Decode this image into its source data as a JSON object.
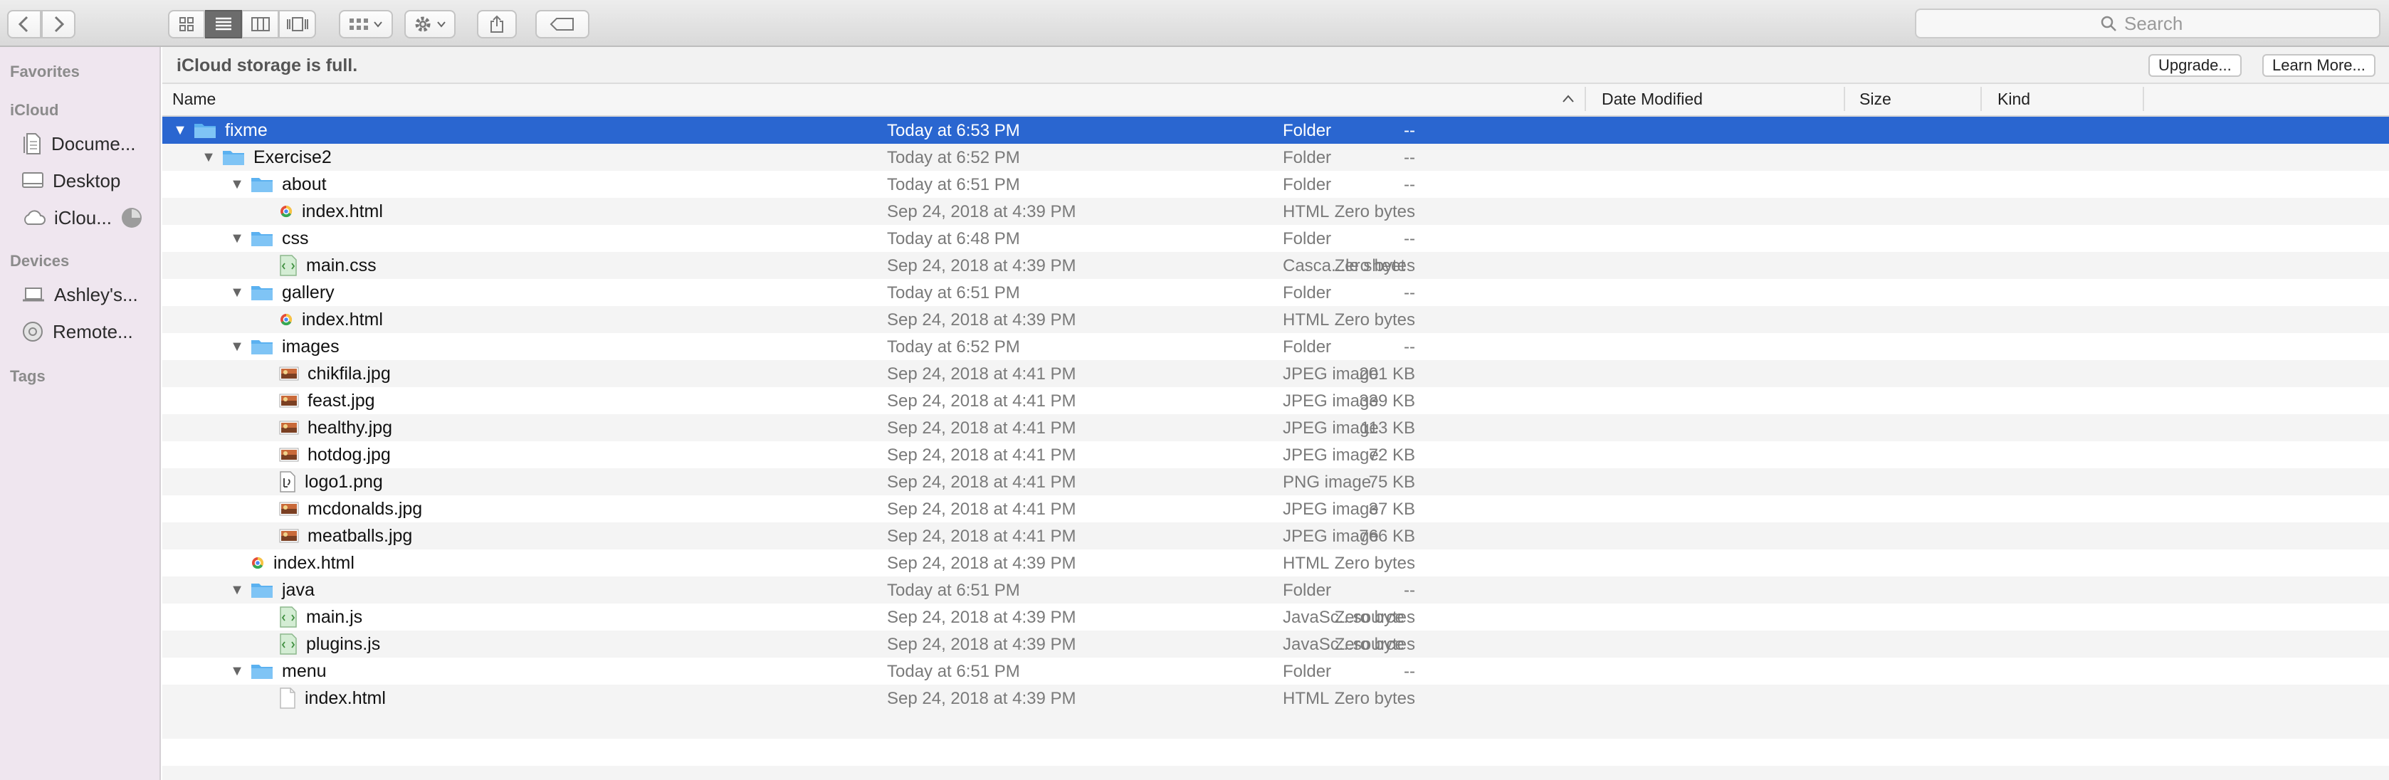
{
  "toolbar": {
    "back_icon": "chevron-left-icon",
    "forward_icon": "chevron-right-icon",
    "views": [
      "icon-view-icon",
      "list-view-icon",
      "column-view-icon",
      "gallery-view-icon"
    ],
    "active_view": "list",
    "group_icon": "group-icon",
    "action_icon": "gear-icon",
    "share_icon": "share-icon",
    "tag_icon": "tag-icon",
    "search_placeholder": "Search"
  },
  "sidebar": {
    "favorites_label": "Favorites",
    "icloud_label": "iCloud",
    "icloud_items": [
      "Docume...",
      "Desktop",
      "iClou..."
    ],
    "devices_label": "Devices",
    "device_items": [
      "Ashley's...",
      "Remote..."
    ],
    "tags_label": "Tags"
  },
  "notice": {
    "text": "iCloud storage is full.",
    "upgrade": "Upgrade...",
    "learn_more": "Learn More..."
  },
  "columns": {
    "name": "Name",
    "date": "Date Modified",
    "size": "Size",
    "kind": "Kind"
  },
  "rows": [
    {
      "name": "fixme",
      "level": 0,
      "type": "folder",
      "date": "Today at 6:53 PM",
      "size": "--",
      "kind": "Folder"
    },
    {
      "name": "Exercise2",
      "level": 1,
      "type": "folder",
      "date": "Today at 6:52 PM",
      "size": "--",
      "kind": "Folder"
    },
    {
      "name": "about",
      "level": 2,
      "type": "folder",
      "date": "Today at 6:51 PM",
      "size": "--",
      "kind": "Folder"
    },
    {
      "name": "index.html",
      "level": 3,
      "type": "html",
      "date": "Sep 24, 2018 at 4:39 PM",
      "size": "Zero bytes",
      "kind": "HTML"
    },
    {
      "name": "css",
      "level": 2,
      "type": "folder",
      "date": "Today at 6:48 PM",
      "size": "--",
      "kind": "Folder"
    },
    {
      "name": "main.css",
      "level": 3,
      "type": "code",
      "date": "Sep 24, 2018 at 4:39 PM",
      "size": "Zero bytes",
      "kind": "Casca...le sheet"
    },
    {
      "name": "gallery",
      "level": 2,
      "type": "folder",
      "date": "Today at 6:51 PM",
      "size": "--",
      "kind": "Folder"
    },
    {
      "name": "index.html",
      "level": 3,
      "type": "html",
      "date": "Sep 24, 2018 at 4:39 PM",
      "size": "Zero bytes",
      "kind": "HTML"
    },
    {
      "name": "images",
      "level": 2,
      "type": "folder",
      "date": "Today at 6:52 PM",
      "size": "--",
      "kind": "Folder"
    },
    {
      "name": "chikfila.jpg",
      "level": 3,
      "type": "image",
      "date": "Sep 24, 2018 at 4:41 PM",
      "size": "201 KB",
      "kind": "JPEG image"
    },
    {
      "name": "feast.jpg",
      "level": 3,
      "type": "image",
      "date": "Sep 24, 2018 at 4:41 PM",
      "size": "339 KB",
      "kind": "JPEG image"
    },
    {
      "name": "healthy.jpg",
      "level": 3,
      "type": "image",
      "date": "Sep 24, 2018 at 4:41 PM",
      "size": "113 KB",
      "kind": "JPEG image"
    },
    {
      "name": "hotdog.jpg",
      "level": 3,
      "type": "image",
      "date": "Sep 24, 2018 at 4:41 PM",
      "size": "72 KB",
      "kind": "JPEG image"
    },
    {
      "name": "logo1.png",
      "level": 3,
      "type": "png",
      "date": "Sep 24, 2018 at 4:41 PM",
      "size": "75 KB",
      "kind": "PNG image"
    },
    {
      "name": "mcdonalds.jpg",
      "level": 3,
      "type": "image",
      "date": "Sep 24, 2018 at 4:41 PM",
      "size": "37 KB",
      "kind": "JPEG image"
    },
    {
      "name": "meatballs.jpg",
      "level": 3,
      "type": "image",
      "date": "Sep 24, 2018 at 4:41 PM",
      "size": "766 KB",
      "kind": "JPEG image"
    },
    {
      "name": "index.html",
      "level": 2,
      "type": "html",
      "date": "Sep 24, 2018 at 4:39 PM",
      "size": "Zero bytes",
      "kind": "HTML"
    },
    {
      "name": "java",
      "level": 2,
      "type": "folder",
      "date": "Today at 6:51 PM",
      "size": "--",
      "kind": "Folder"
    },
    {
      "name": "main.js",
      "level": 3,
      "type": "code",
      "date": "Sep 24, 2018 at 4:39 PM",
      "size": "Zero bytes",
      "kind": "JavaSc...source"
    },
    {
      "name": "plugins.js",
      "level": 3,
      "type": "code",
      "date": "Sep 24, 2018 at 4:39 PM",
      "size": "Zero bytes",
      "kind": "JavaSc...source"
    },
    {
      "name": "menu",
      "level": 2,
      "type": "folder",
      "date": "Today at 6:51 PM",
      "size": "--",
      "kind": "Folder"
    },
    {
      "name": "index.html",
      "level": 3,
      "type": "blank",
      "date": "Sep 24, 2018 at 4:39 PM",
      "size": "Zero bytes",
      "kind": "HTML"
    }
  ],
  "selected_row": 0,
  "colors": {
    "selection": "#2a66d0",
    "sidebar_bg": "#efe6ef",
    "folder": "#5bb1f0"
  }
}
